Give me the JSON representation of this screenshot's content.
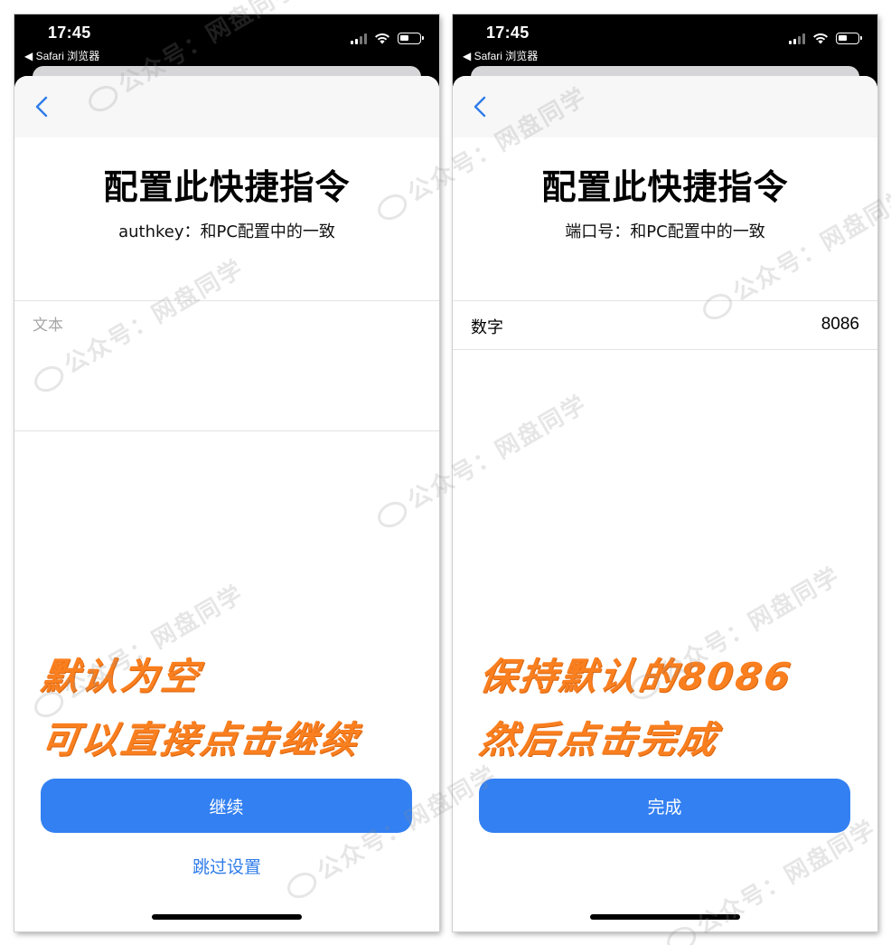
{
  "left_screen": {
    "status_bar": {
      "time": "17:45",
      "back_app": "◀ Safari 浏览器"
    },
    "sheet": {
      "title": "配置此快捷指令",
      "subtitle": "authkey：和PC配置中的一致",
      "text_input": {
        "placeholder": "文本",
        "value": ""
      },
      "annotation_line1": "默认为空",
      "annotation_line2": "可以直接点击继续",
      "primary_button": "继续",
      "secondary_link": "跳过设置"
    }
  },
  "right_screen": {
    "status_bar": {
      "time": "17:45",
      "back_app": "◀ Safari 浏览器"
    },
    "sheet": {
      "title": "配置此快捷指令",
      "subtitle": "端口号：和PC配置中的一致",
      "number_field": {
        "label": "数字",
        "value": "8086"
      },
      "annotation_line1": "保持默认的8086",
      "annotation_line2": "然后点击完成",
      "primary_button": "完成"
    }
  },
  "watermark_text": "公众号：网盘同学",
  "colors": {
    "accent_blue": "#3380f2",
    "link_blue": "#2f7ce9",
    "annotation_orange": "#fa7f1f"
  },
  "icons": {
    "status": [
      "signal-icon",
      "wifi-icon",
      "battery-icon"
    ],
    "nav": "chevron-left-icon"
  }
}
